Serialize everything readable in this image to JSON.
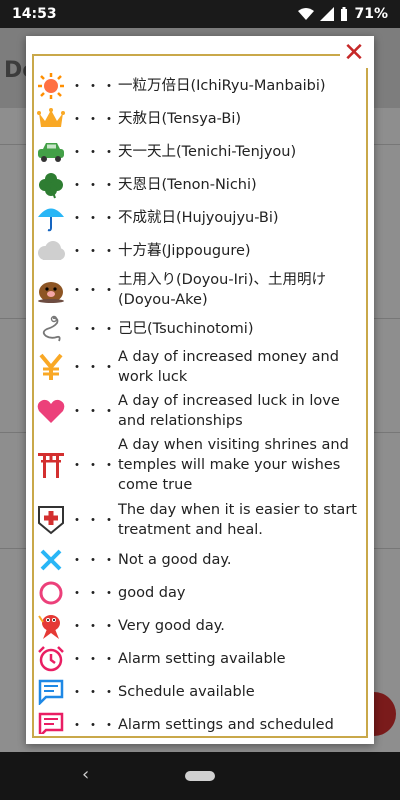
{
  "status_bar": {
    "time": "14:53",
    "battery": "71%"
  },
  "background": {
    "title": "De"
  },
  "dialog": {
    "close_symbol": "✕",
    "legend": [
      {
        "icon": "sun-icon",
        "dots": "・・・",
        "text": "一粒万倍日(IchiRyu-Manbaibi)"
      },
      {
        "icon": "crown-icon",
        "dots": "・・・",
        "text": "天赦日(Tensya-Bi)"
      },
      {
        "icon": "car-icon",
        "dots": "・・・",
        "text": "天一天上(Tenichi-Tenjyou)"
      },
      {
        "icon": "clover-icon",
        "dots": "・・・",
        "text": "天恩日(Tenon-Nichi)"
      },
      {
        "icon": "umbrella-icon",
        "dots": "・・・",
        "text": "不成就日(Hujyoujyu-Bi)"
      },
      {
        "icon": "cloud-icon",
        "dots": "・・・",
        "text": "十方暮(Jippougure)"
      },
      {
        "icon": "mole-icon",
        "dots": "・・・",
        "text": "土用入り(Doyou-Iri)、土用明け(Doyou-Ake)"
      },
      {
        "icon": "snake-icon",
        "dots": "・・・",
        "text": "己巳(Tsuchinotomi)"
      },
      {
        "icon": "yen-icon",
        "dots": "・・・",
        "text": "A day of increased money and work luck"
      },
      {
        "icon": "heart-icon",
        "dots": "・・・",
        "text": "A day of increased luck in love and relationships"
      },
      {
        "icon": "torii-icon",
        "dots": "・・・",
        "text": "A day when visiting shrines and temples will make your wishes come true"
      },
      {
        "icon": "medical-cross-icon",
        "dots": "・・・",
        "text": "The day when it is easier to start treatment and heal."
      },
      {
        "icon": "cross-mark-icon",
        "dots": "・・・",
        "text": "Not a good day."
      },
      {
        "icon": "circle-icon",
        "dots": "・・・",
        "text": "good day"
      },
      {
        "icon": "sea-bream-icon",
        "dots": "・・・",
        "text": "Very good day."
      },
      {
        "icon": "alarm-clock-icon",
        "dots": "・・・",
        "text": "Alarm setting available"
      },
      {
        "icon": "schedule-icon",
        "dots": "・・・",
        "text": "Schedule available"
      },
      {
        "icon": "alarm-schedule-icon",
        "dots": "・・・",
        "text": "Alarm settings and scheduled"
      }
    ]
  },
  "colors": {
    "gold": "#c9a84a",
    "close": "#c62828",
    "pink": "#e91e63",
    "blue": "#1e88e5"
  }
}
